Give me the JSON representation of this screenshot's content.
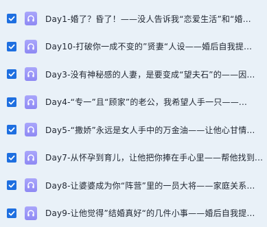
{
  "episodes": [
    {
      "title": "Day1-婚了？昏了！——没人告诉我“恋爱生活”和“婚...",
      "checked": true
    },
    {
      "title": "Day10-打破你一成不变的”贤妻“人设——婚后自我提...",
      "checked": true
    },
    {
      "title": "Day3-没有神秘感的人妻，是要变成“望夫石”的——因...",
      "checked": true
    },
    {
      "title": "Day4-“专一”且“顾家”的老公，我希望人手一只——...",
      "checked": true
    },
    {
      "title": "Day5-“撒娇”永远是女人手中的万金油——让他心甘情...",
      "checked": true
    },
    {
      "title": "Day7-从怀孕到育儿，让他把你捧在手心里——帮他找到...",
      "checked": true
    },
    {
      "title": "Day8-让婆婆成为你“阵营”里的一员大将——家庭关系...",
      "checked": true
    },
    {
      "title": "Day9-让他觉得”结婚真好“的几件小事——婚后自我提...",
      "checked": true
    }
  ],
  "icons": {
    "checkbox": "checkbox-checked-icon",
    "audio": "headphones-icon"
  },
  "colors": {
    "background": "#e9f1f8",
    "checkbox": "#1e6fe0",
    "audio_icon": "#9a96f7",
    "text": "#1f2530"
  }
}
